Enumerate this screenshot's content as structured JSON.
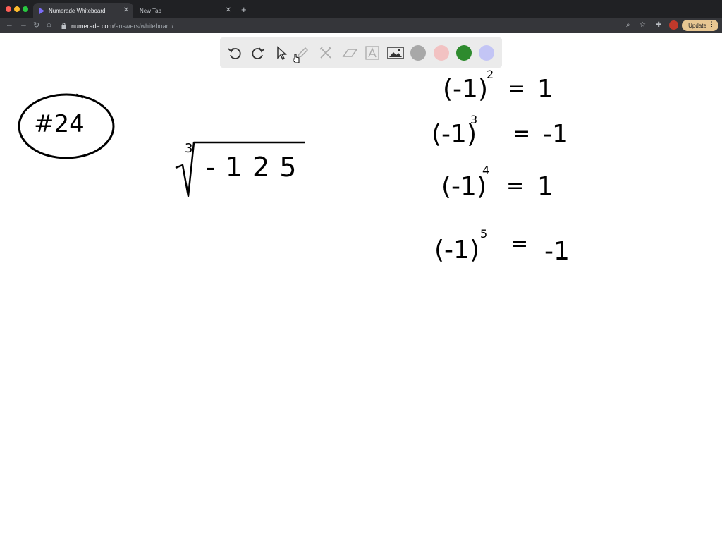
{
  "browser": {
    "tabs": [
      {
        "title": "Numerade Whiteboard",
        "active": true
      },
      {
        "title": "New Tab",
        "active": false
      }
    ],
    "url_host": "numerade.com",
    "url_path": "/answers/whiteboard/",
    "update_label": "Update"
  },
  "toolbar": {
    "tools": [
      "undo-icon",
      "redo-icon",
      "pointer-icon",
      "pen-icon",
      "tools-icon",
      "eraser-icon",
      "text-icon",
      "image-icon"
    ],
    "colors": [
      "#a8a8a8",
      "#f2c2c2",
      "#2e8b2e",
      "#c3c5f5"
    ]
  },
  "whiteboard": {
    "problem_label": "#24",
    "radical_index": "3",
    "radicand": "- 1 2 5",
    "equations": [
      {
        "base": "(-1)",
        "exp": "2",
        "rhs": "1"
      },
      {
        "base": "(-1)",
        "exp": "3",
        "rhs": "-1"
      },
      {
        "base": "(-1)",
        "exp": "4",
        "rhs": "1"
      },
      {
        "base": "(-1)",
        "exp": "5",
        "rhs": "-1"
      }
    ]
  }
}
